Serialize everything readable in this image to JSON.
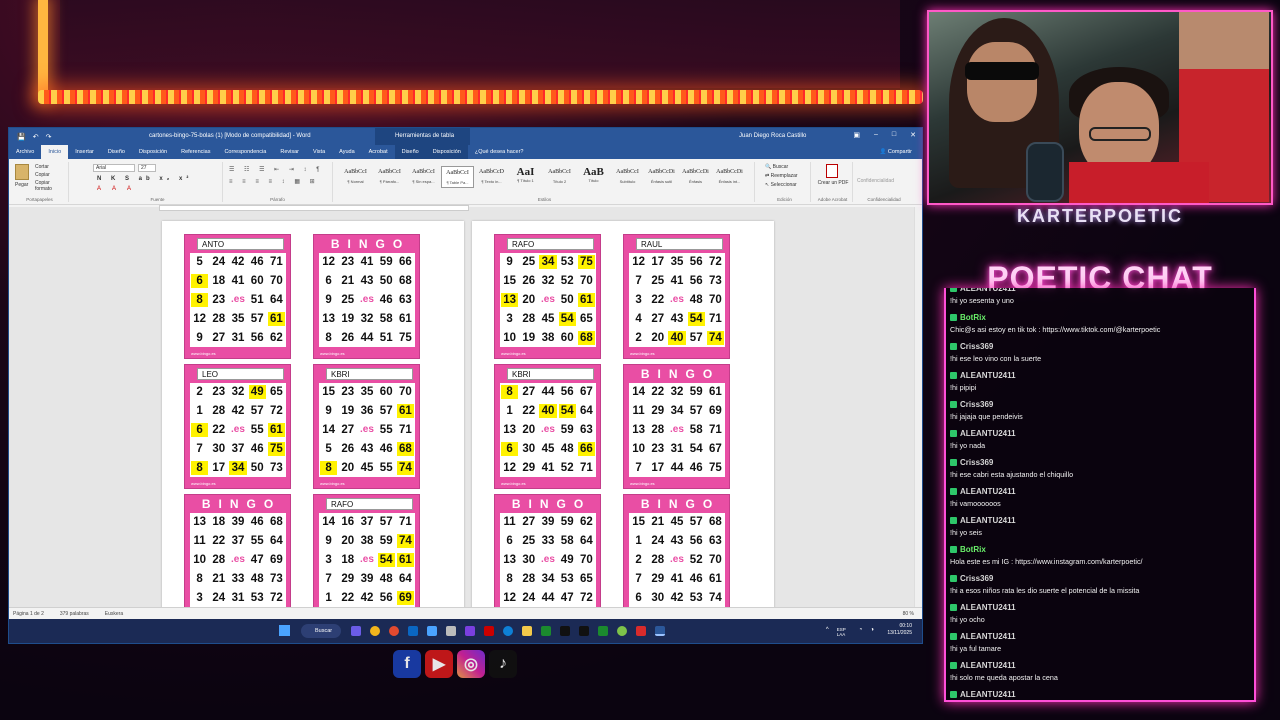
{
  "word": {
    "title": "cartones-bingo-75-bolas (1) [Modo de compatibilidad] - Word",
    "context_tab": "Herramientas de tabla",
    "user": "Juan Diego Roca Castillo",
    "tabs": [
      "Archivo",
      "Inicio",
      "Insertar",
      "Diseño",
      "Disposición",
      "Referencias",
      "Correspondencia",
      "Revisar",
      "Vista",
      "Ayuda",
      "Acrobat",
      "Diseño",
      "Disposición"
    ],
    "tell_me": "¿Qué desea hacer?",
    "share": "Compartir",
    "ribbon": {
      "paste": "Pegar",
      "cut": "Cortar",
      "copy": "Copiar",
      "format_painter": "Copiar formato",
      "font_name": "Arial",
      "font_size": "27",
      "find": "Buscar",
      "replace": "Reemplazar",
      "select": "Seleccionar",
      "create_pdf": "Crear un PDF",
      "confidentiality": "Confidencialidad",
      "group_labels": [
        "Portapapeles",
        "Fuente",
        "Párrafo",
        "Estilos",
        "Edición",
        "Adobe Acrobat",
        "Confidencialidad"
      ],
      "styles": [
        {
          "sample": "AaBbCcI",
          "name": "¶ Normal"
        },
        {
          "sample": "AaBbCcI",
          "name": "¶ Párrafo..."
        },
        {
          "sample": "AaBbCcI",
          "name": "¶ Sin espa..."
        },
        {
          "sample": "AaBbCcI",
          "name": "¶ Table Pa..."
        },
        {
          "sample": "AaBbCcD",
          "name": "¶ Texto in..."
        },
        {
          "sample": "AaI",
          "name": "¶ Título 1"
        },
        {
          "sample": "AaBbCcI",
          "name": "Título 2"
        },
        {
          "sample": "AaB",
          "name": "Título"
        },
        {
          "sample": "AaBbCcI",
          "name": "Subtítulo"
        },
        {
          "sample": "AaBbCcDi",
          "name": "Énfasis sutil"
        },
        {
          "sample": "AaBbCcDi",
          "name": "Énfasis"
        },
        {
          "sample": "AaBbCcDi",
          "name": "Énfasis int..."
        }
      ]
    },
    "status": {
      "page": "Página 1 de 2",
      "words": "379 palabras",
      "lang": "Euskera",
      "zoom": "80 %"
    },
    "taskbar": {
      "search": "Buscar",
      "lang": "ESP LAA",
      "time": "00:10",
      "date": "13/11/2025"
    }
  },
  "bingo_word": "BINGO",
  "card_footer": "www.bingo.es",
  "cards": [
    {
      "name": "ANTO",
      "rows": [
        [
          "5",
          "24",
          "42",
          "46",
          "71"
        ],
        [
          "6",
          "18",
          "41",
          "60",
          "70"
        ],
        [
          "8",
          "23",
          ".es",
          "51",
          "64"
        ],
        [
          "12",
          "28",
          "35",
          "57",
          "61"
        ],
        [
          "9",
          "27",
          "31",
          "56",
          "62"
        ]
      ],
      "hl": [
        "6",
        "8",
        "61"
      ]
    },
    {
      "name": "",
      "rows": [
        [
          "12",
          "23",
          "41",
          "59",
          "66"
        ],
        [
          "6",
          "21",
          "43",
          "50",
          "68"
        ],
        [
          "9",
          "25",
          ".es",
          "46",
          "63"
        ],
        [
          "13",
          "19",
          "32",
          "58",
          "61"
        ],
        [
          "8",
          "26",
          "44",
          "51",
          "75"
        ]
      ],
      "hl": []
    },
    {
      "name": "RAFO",
      "rows": [
        [
          "9",
          "25",
          "34",
          "53",
          "75"
        ],
        [
          "15",
          "26",
          "32",
          "52",
          "70"
        ],
        [
          "13",
          "20",
          ".es",
          "50",
          "61"
        ],
        [
          "3",
          "28",
          "45",
          "54",
          "65"
        ],
        [
          "10",
          "19",
          "38",
          "60",
          "68"
        ]
      ],
      "hl": [
        "34",
        "75",
        "13",
        "61",
        "54",
        "68"
      ]
    },
    {
      "name": "RAUL",
      "rows": [
        [
          "12",
          "17",
          "35",
          "56",
          "72"
        ],
        [
          "7",
          "25",
          "41",
          "56",
          "73"
        ],
        [
          "3",
          "22",
          ".es",
          "48",
          "70"
        ],
        [
          "4",
          "27",
          "43",
          "54",
          "71"
        ],
        [
          "2",
          "20",
          "40",
          "57",
          "74"
        ]
      ],
      "hl": [
        "54",
        "40",
        "74"
      ]
    },
    {
      "name": "LEO",
      "rows": [
        [
          "2",
          "23",
          "32",
          "49",
          "65"
        ],
        [
          "1",
          "28",
          "42",
          "57",
          "72"
        ],
        [
          "6",
          "22",
          ".es",
          "55",
          "61"
        ],
        [
          "7",
          "30",
          "37",
          "46",
          "75"
        ],
        [
          "8",
          "17",
          "34",
          "50",
          "73"
        ]
      ],
      "hl": [
        "49",
        "6",
        "61",
        "75",
        "8",
        "34"
      ]
    },
    {
      "name": "KBRI",
      "rows": [
        [
          "15",
          "23",
          "35",
          "60",
          "70"
        ],
        [
          "9",
          "19",
          "36",
          "57",
          "61"
        ],
        [
          "14",
          "27",
          ".es",
          "55",
          "71"
        ],
        [
          "5",
          "26",
          "43",
          "46",
          "68"
        ],
        [
          "8",
          "20",
          "45",
          "55",
          "74"
        ]
      ],
      "hl": [
        "61",
        "68",
        "8",
        "74"
      ]
    },
    {
      "name": "KBRI",
      "rows": [
        [
          "8",
          "27",
          "44",
          "56",
          "67"
        ],
        [
          "1",
          "22",
          "40",
          "54",
          "64"
        ],
        [
          "13",
          "20",
          ".es",
          "59",
          "63"
        ],
        [
          "6",
          "30",
          "45",
          "48",
          "66"
        ],
        [
          "12",
          "29",
          "41",
          "52",
          "71"
        ]
      ],
      "hl": [
        "8",
        "40",
        "54",
        "6",
        "66"
      ]
    },
    {
      "name": "",
      "rows": [
        [
          "14",
          "22",
          "32",
          "59",
          "61"
        ],
        [
          "11",
          "29",
          "34",
          "57",
          "69"
        ],
        [
          "13",
          "28",
          ".es",
          "58",
          "71"
        ],
        [
          "10",
          "23",
          "31",
          "54",
          "67"
        ],
        [
          "7",
          "17",
          "44",
          "46",
          "75"
        ]
      ],
      "hl": []
    },
    {
      "name": "",
      "rows": [
        [
          "13",
          "18",
          "39",
          "46",
          "68"
        ],
        [
          "11",
          "22",
          "37",
          "55",
          "64"
        ],
        [
          "10",
          "28",
          ".es",
          "47",
          "69"
        ],
        [
          "8",
          "21",
          "33",
          "48",
          "73"
        ],
        [
          "3",
          "24",
          "31",
          "53",
          "72"
        ]
      ],
      "hl": []
    },
    {
      "name": "RAFO",
      "rows": [
        [
          "14",
          "16",
          "37",
          "57",
          "71"
        ],
        [
          "9",
          "20",
          "38",
          "59",
          "74"
        ],
        [
          "3",
          "18",
          ".es",
          "54",
          "61"
        ],
        [
          "7",
          "29",
          "39",
          "48",
          "64"
        ],
        [
          "1",
          "22",
          "42",
          "56",
          "69"
        ]
      ],
      "hl": [
        "74",
        "54",
        "61",
        "69"
      ]
    },
    {
      "name": "",
      "rows": [
        [
          "11",
          "27",
          "39",
          "59",
          "62"
        ],
        [
          "6",
          "25",
          "33",
          "58",
          "64"
        ],
        [
          "13",
          "30",
          ".es",
          "49",
          "70"
        ],
        [
          "8",
          "28",
          "34",
          "53",
          "65"
        ],
        [
          "12",
          "24",
          "44",
          "47",
          "72"
        ]
      ],
      "hl": []
    },
    {
      "name": "",
      "rows": [
        [
          "15",
          "21",
          "45",
          "57",
          "68"
        ],
        [
          "1",
          "24",
          "43",
          "56",
          "63"
        ],
        [
          "2",
          "28",
          ".es",
          "52",
          "70"
        ],
        [
          "7",
          "29",
          "41",
          "46",
          "61"
        ],
        [
          "6",
          "30",
          "42",
          "53",
          "74"
        ]
      ],
      "hl": []
    }
  ],
  "stream": {
    "streamer": "KARTERPOETIC",
    "chat_title": "POETIC CHAT",
    "messages": [
      {
        "user": "ALEANTU2411",
        "text": "!hi yo sesenta y uno",
        "bot": false
      },
      {
        "user": "BotRix",
        "text": "Chic@s asi estoy en tik tok : https://www.tiktok.com/@karterpoetic",
        "bot": true
      },
      {
        "user": "Criss369",
        "text": "!hi ese leo vino con la suerte",
        "bot": false
      },
      {
        "user": "ALEANTU2411",
        "text": "!hi pipipi",
        "bot": false
      },
      {
        "user": "Criss369",
        "text": "!hi jajaja que pendeivis",
        "bot": false
      },
      {
        "user": "ALEANTU2411",
        "text": "!hi yo nada",
        "bot": false
      },
      {
        "user": "Criss369",
        "text": "!hi ese cabri esta ajustando el chiquillo",
        "bot": false
      },
      {
        "user": "ALEANTU2411",
        "text": "!hi vamoooooos",
        "bot": false
      },
      {
        "user": "ALEANTU2411",
        "text": "!hi yo seis",
        "bot": false
      },
      {
        "user": "BotRix",
        "text": "Hola este es mi IG : https://www.instagram.com/karterpoetic/",
        "bot": true
      },
      {
        "user": "Criss369",
        "text": "!hi a esos niños rata les dio suerte el potencial de la missita",
        "bot": false
      },
      {
        "user": "ALEANTU2411",
        "text": "!hi yo ocho",
        "bot": false
      },
      {
        "user": "ALEANTU2411",
        "text": "!hi ya ful tamare",
        "bot": false
      },
      {
        "user": "ALEANTU2411",
        "text": "!hi solo me queda apostar la cena",
        "bot": false
      },
      {
        "user": "ALEANTU2411",
        "text": "!hi yo seis seis",
        "bot": false
      }
    ]
  },
  "colors": {
    "word_blue": "#2b579a",
    "card_pink": "#e94ea4",
    "highlight": "#fff200",
    "neon": "#ff4fd8"
  }
}
